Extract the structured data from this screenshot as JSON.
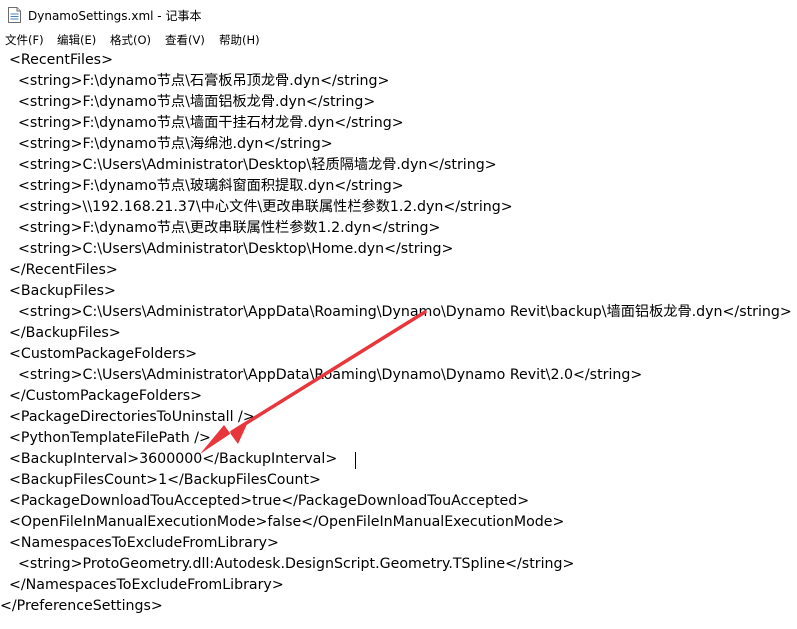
{
  "window": {
    "title": "DynamoSettings.xml - 记事本"
  },
  "menu": {
    "items": [
      "文件(F)",
      "编辑(E)",
      "格式(O)",
      "查看(V)",
      "帮助(H)"
    ]
  },
  "editor": {
    "lines": [
      "  <RecentFiles>",
      "    <string>F:\\dynamo节点\\石膏板吊顶龙骨.dyn</string>",
      "    <string>F:\\dynamo节点\\墙面铝板龙骨.dyn</string>",
      "    <string>F:\\dynamo节点\\墙面干挂石材龙骨.dyn</string>",
      "    <string>F:\\dynamo节点\\海绵池.dyn</string>",
      "    <string>C:\\Users\\Administrator\\Desktop\\轻质隔墙龙骨.dyn</string>",
      "    <string>F:\\dynamo节点\\玻璃斜窗面积提取.dyn</string>",
      "    <string>\\\\192.168.21.37\\中心文件\\更改串联属性栏参数1.2.dyn</string>",
      "    <string>F:\\dynamo节点\\更改串联属性栏参数1.2.dyn</string>",
      "    <string>C:\\Users\\Administrator\\Desktop\\Home.dyn</string>",
      "  </RecentFiles>",
      "  <BackupFiles>",
      "    <string>C:\\Users\\Administrator\\AppData\\Roaming\\Dynamo\\Dynamo Revit\\backup\\墙面铝板龙骨.dyn</string>",
      "  </BackupFiles>",
      "  <CustomPackageFolders>",
      "    <string>C:\\Users\\Administrator\\AppData\\Roaming\\Dynamo\\Dynamo Revit\\2.0</string>",
      "  </CustomPackageFolders>",
      "  <PackageDirectoriesToUninstall />",
      "  <PythonTemplateFilePath />",
      "  <BackupInterval>3600000</BackupInterval>",
      "  <BackupFilesCount>1</BackupFilesCount>",
      "  <PackageDownloadTouAccepted>true</PackageDownloadTouAccepted>",
      "  <OpenFileInManualExecutionMode>false</OpenFileInManualExecutionMode>",
      "  <NamespacesToExcludeFromLibrary>",
      "    <string>ProtoGeometry.dll:Autodesk.DesignScript.Geometry.TSpline</string>",
      "  </NamespacesToExcludeFromLibrary>",
      "</PreferenceSettings>"
    ]
  },
  "annotation": {
    "arrow_color": "#e8373c"
  }
}
